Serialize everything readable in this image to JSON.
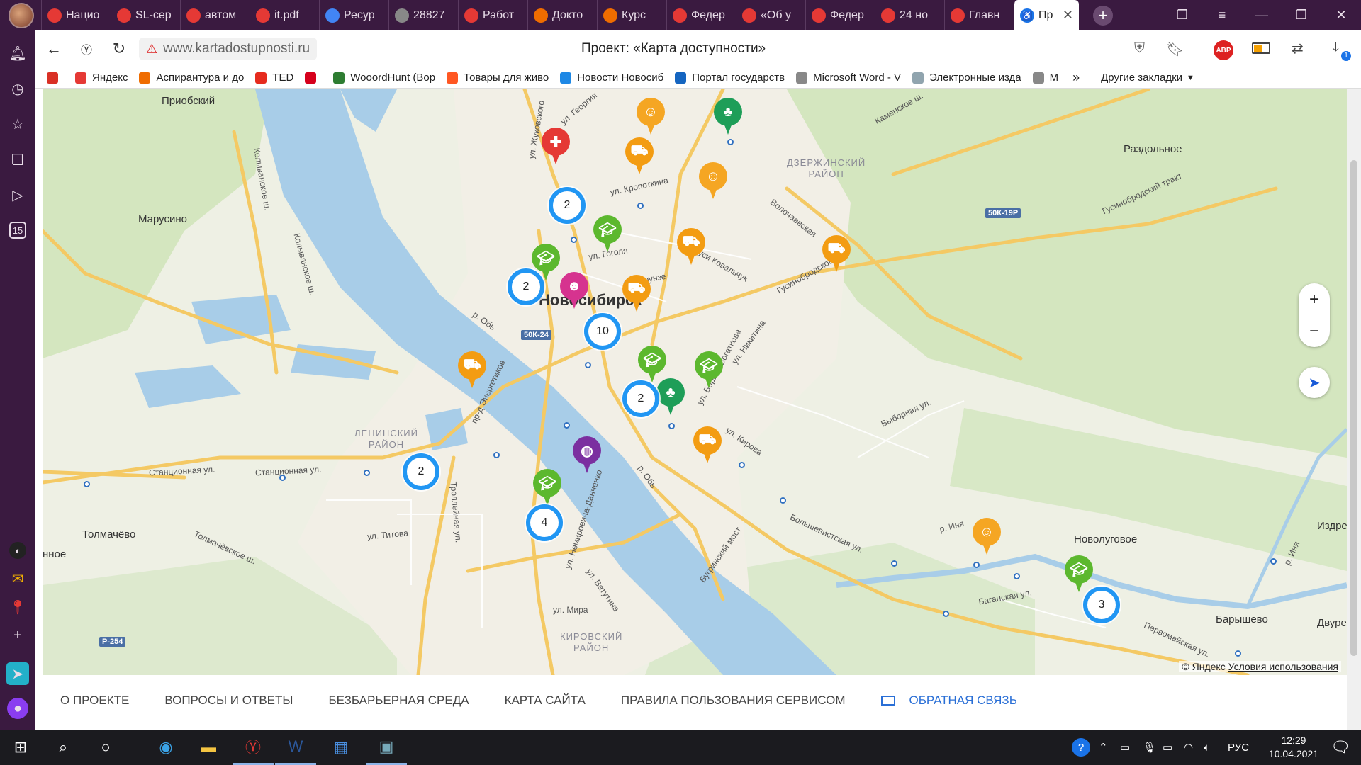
{
  "browser": {
    "tabs": [
      {
        "label": "Нацио",
        "icon": "bookmark-red-icon",
        "color": "#e53935"
      },
      {
        "label": "SL-сер",
        "icon": "yandex-icon",
        "color": "#e53935"
      },
      {
        "label": "автом",
        "icon": "yandex-icon",
        "color": "#e53935"
      },
      {
        "label": "it.pdf",
        "icon": "pdf-icon",
        "color": "#e53935"
      },
      {
        "label": "Ресур",
        "icon": "google-icon",
        "color": "#4285f4"
      },
      {
        "label": "28827",
        "icon": "document-icon",
        "color": "#888888"
      },
      {
        "label": "Работ",
        "icon": "yandex-icon",
        "color": "#e53935"
      },
      {
        "label": "Докто",
        "icon": "hh-icon",
        "color": "#ef6c00"
      },
      {
        "label": "Курс",
        "icon": "courses-icon",
        "color": "#ef6c00"
      },
      {
        "label": "Федер",
        "icon": "yandex-icon",
        "color": "#e53935"
      },
      {
        "label": "«Об у",
        "icon": "yandex-icon",
        "color": "#e53935"
      },
      {
        "label": "Федер",
        "icon": "yandex-icon",
        "color": "#e53935"
      },
      {
        "label": "24 но",
        "icon": "yandex-icon",
        "color": "#e53935"
      },
      {
        "label": "Главн",
        "icon": "yandex-icon",
        "color": "#e53935"
      }
    ],
    "active_tab": {
      "label": "Пр",
      "icon": "accessibility-icon"
    },
    "url": "www.kartadostupnosti.ru",
    "page_title": "Проект: «Карта доступности»",
    "adblock_label": "ABP",
    "bookmarks": [
      {
        "label": "",
        "icon": "gmail-icon",
        "color": "#d93025"
      },
      {
        "label": "Яндекс",
        "icon": "yandex-icon",
        "color": "#e53935"
      },
      {
        "label": "Аспирантура и до",
        "icon": "hh-icon",
        "color": "#ef6c00"
      },
      {
        "label": "TED",
        "icon": "ted-icon",
        "color": "#e62b1e"
      },
      {
        "label": "",
        "icon": "hh-icon",
        "color": "#d6001c"
      },
      {
        "label": "WooordHunt (Вор",
        "icon": "wooordhunt-icon",
        "color": "#2e7d32"
      },
      {
        "label": "Товары для живо",
        "icon": "pet-store-icon",
        "color": "#ff5722"
      },
      {
        "label": "Новости Новосиб",
        "icon": "news-icon",
        "color": "#1e88e5"
      },
      {
        "label": "Портал государств",
        "icon": "flag-icon",
        "color": "#1565c0"
      },
      {
        "label": "Microsoft Word - V",
        "icon": "document-icon",
        "color": "#888888"
      },
      {
        "label": "Электронные изда",
        "icon": "globe-icon",
        "color": "#90a4ae"
      },
      {
        "label": "M",
        "icon": "document-icon",
        "color": "#888888"
      }
    ],
    "other_bookmarks": "Другие закладки",
    "download_badge": "1"
  },
  "sidebar_badge": "15",
  "map": {
    "places": [
      {
        "label": "Приобский"
      },
      {
        "label": "Марусино"
      },
      {
        "label": "Раздольное"
      },
      {
        "label": "Толмачёво"
      },
      {
        "label": "нное"
      },
      {
        "label": "Новолуговое"
      },
      {
        "label": "Барышево"
      },
      {
        "label": "Издре"
      },
      {
        "label": "Двуре"
      }
    ],
    "city": "Новосибирск",
    "districts": [
      {
        "label": "ДЗЕРЖИНСКИЙ\nРАЙОН"
      },
      {
        "label": "ЛЕНИНСКИЙ\nРАЙОН"
      },
      {
        "label": "КИРОВСКИЙ\nРАЙОН"
      }
    ],
    "streets": [
      {
        "label": "ул. Жуковского"
      },
      {
        "label": "ул. Георгия"
      },
      {
        "label": "ул. Кропоткина"
      },
      {
        "label": "ул. Гоголя"
      },
      {
        "label": "ул. Фрунзе"
      },
      {
        "label": "ул. Дуси Ковальчук"
      },
      {
        "label": "Волочаевская"
      },
      {
        "label": "Гусинобродское ш."
      },
      {
        "label": "Гусинобродский тракт"
      },
      {
        "label": "Каменское ш."
      },
      {
        "label": "пр-д Энергетиков"
      },
      {
        "label": "Станционная ул."
      },
      {
        "label": "Станционная ул."
      },
      {
        "label": "Толмачёвское ш."
      },
      {
        "label": "Троллейная ул."
      },
      {
        "label": "ул. Титова"
      },
      {
        "label": "ул. Немировича-Данченко"
      },
      {
        "label": "ул. Ватутина"
      },
      {
        "label": "ул. Мира"
      },
      {
        "label": "Бугринский мост"
      },
      {
        "label": "Большевистская ул."
      },
      {
        "label": "ул. Кирова"
      },
      {
        "label": "ул. Бориса Богаткова"
      },
      {
        "label": "ул. Никитина"
      },
      {
        "label": "Выборная ул."
      },
      {
        "label": "Баганская ул."
      },
      {
        "label": "Первомайская ул."
      },
      {
        "label": "р. Обь"
      },
      {
        "label": "р. Обь"
      },
      {
        "label": "р. Иня"
      },
      {
        "label": "р. Иня"
      },
      {
        "label": "Колыванское ш."
      },
      {
        "label": "Колыванское ш."
      }
    ],
    "road_badges": [
      "50К-19Р",
      "50К-24",
      "Р-254"
    ],
    "clusters": [
      "2",
      "2",
      "10",
      "2",
      "2",
      "4",
      "3"
    ],
    "pins": [
      {
        "kind": "medical-cross-icon",
        "color": "#e53935"
      },
      {
        "kind": "people-icon",
        "color": "#f5a623"
      },
      {
        "kind": "palm-tree-icon",
        "color": "#1e9e58"
      },
      {
        "kind": "shopping-cart-icon",
        "color": "#f39c12"
      },
      {
        "kind": "people-icon",
        "color": "#f5a623"
      },
      {
        "kind": "graduation-cap-icon",
        "color": "#5cb82e"
      },
      {
        "kind": "shopping-cart-icon",
        "color": "#f39c12"
      },
      {
        "kind": "shopping-cart-icon",
        "color": "#f39c12"
      },
      {
        "kind": "graduation-cap-icon",
        "color": "#5cb82e"
      },
      {
        "kind": "theater-masks-icon",
        "color": "#d6338f"
      },
      {
        "kind": "shopping-cart-icon",
        "color": "#f39c12"
      },
      {
        "kind": "shopping-cart-icon",
        "color": "#f39c12"
      },
      {
        "kind": "graduation-cap-icon",
        "color": "#5cb82e"
      },
      {
        "kind": "graduation-cap-icon",
        "color": "#5cb82e"
      },
      {
        "kind": "palm-tree-icon",
        "color": "#1e9e58"
      },
      {
        "kind": "shopping-cart-icon",
        "color": "#f39c12"
      },
      {
        "kind": "basketball-icon",
        "color": "#7b2fa0"
      },
      {
        "kind": "graduation-cap-icon",
        "color": "#5cb82e"
      },
      {
        "kind": "people-icon",
        "color": "#f5a623"
      },
      {
        "kind": "graduation-cap-icon",
        "color": "#5cb82e"
      }
    ],
    "zoom_in": "+",
    "zoom_out": "−",
    "copyright": "© Яндекс",
    "terms_link": "Условия использования"
  },
  "footer": {
    "links": [
      "О проекте",
      "Вопросы и ответы",
      "Безбарьерная среда",
      "Карта сайта",
      "Правила пользования сервисом"
    ],
    "feedback": "Обратная связь"
  },
  "taskbar": {
    "lang": "РУС",
    "time": "12:29",
    "date": "10.04.2021"
  }
}
